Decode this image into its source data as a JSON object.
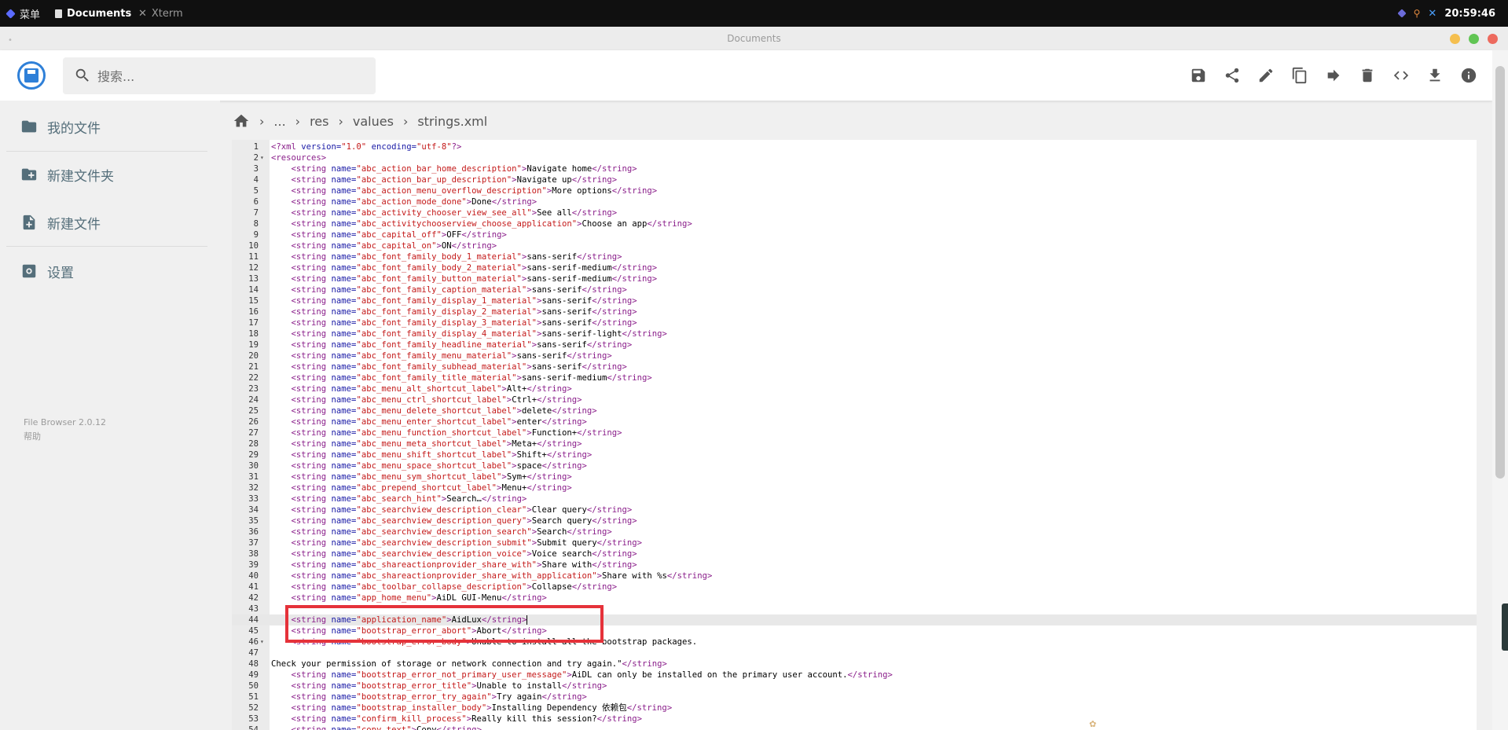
{
  "taskbar": {
    "menu_label": "菜单",
    "docs_label": "Documents",
    "xterm_label": "Xterm",
    "clock": "20:59:46"
  },
  "window": {
    "title": "Documents"
  },
  "search": {
    "placeholder": "搜索..."
  },
  "toolbar": {
    "actions": [
      "save",
      "share",
      "edit",
      "copy",
      "move",
      "delete",
      "code-view",
      "download",
      "info"
    ]
  },
  "sidebar": {
    "items": [
      {
        "label": "我的文件",
        "icon": "folder-icon"
      },
      {
        "label": "新建文件夹",
        "icon": "new-folder-icon"
      },
      {
        "label": "新建文件",
        "icon": "new-file-icon"
      },
      {
        "label": "设置",
        "icon": "settings-icon"
      }
    ],
    "footer_version": "File Browser 2.0.12",
    "footer_help": "帮助"
  },
  "breadcrumb": {
    "items": [
      "...",
      "res",
      "values",
      "strings.xml"
    ]
  },
  "editor": {
    "active_line": 44,
    "lines": [
      {
        "n": "1",
        "text": "<?xml version=\"1.0\" encoding=\"utf-8\"?>"
      },
      {
        "n": "2",
        "text": "<resources>",
        "fold": true
      },
      {
        "n": "3",
        "text": "    <string name=\"abc_action_bar_home_description\">Navigate home</string>"
      },
      {
        "n": "4",
        "text": "    <string name=\"abc_action_bar_up_description\">Navigate up</string>"
      },
      {
        "n": "5",
        "text": "    <string name=\"abc_action_menu_overflow_description\">More options</string>"
      },
      {
        "n": "6",
        "text": "    <string name=\"abc_action_mode_done\">Done</string>"
      },
      {
        "n": "7",
        "text": "    <string name=\"abc_activity_chooser_view_see_all\">See all</string>"
      },
      {
        "n": "8",
        "text": "    <string name=\"abc_activitychooserview_choose_application\">Choose an app</string>"
      },
      {
        "n": "9",
        "text": "    <string name=\"abc_capital_off\">OFF</string>"
      },
      {
        "n": "10",
        "text": "    <string name=\"abc_capital_on\">ON</string>"
      },
      {
        "n": "11",
        "text": "    <string name=\"abc_font_family_body_1_material\">sans-serif</string>"
      },
      {
        "n": "12",
        "text": "    <string name=\"abc_font_family_body_2_material\">sans-serif-medium</string>"
      },
      {
        "n": "13",
        "text": "    <string name=\"abc_font_family_button_material\">sans-serif-medium</string>"
      },
      {
        "n": "14",
        "text": "    <string name=\"abc_font_family_caption_material\">sans-serif</string>"
      },
      {
        "n": "15",
        "text": "    <string name=\"abc_font_family_display_1_material\">sans-serif</string>"
      },
      {
        "n": "16",
        "text": "    <string name=\"abc_font_family_display_2_material\">sans-serif</string>"
      },
      {
        "n": "17",
        "text": "    <string name=\"abc_font_family_display_3_material\">sans-serif</string>"
      },
      {
        "n": "18",
        "text": "    <string name=\"abc_font_family_display_4_material\">sans-serif-light</string>"
      },
      {
        "n": "19",
        "text": "    <string name=\"abc_font_family_headline_material\">sans-serif</string>"
      },
      {
        "n": "20",
        "text": "    <string name=\"abc_font_family_menu_material\">sans-serif</string>"
      },
      {
        "n": "21",
        "text": "    <string name=\"abc_font_family_subhead_material\">sans-serif</string>"
      },
      {
        "n": "22",
        "text": "    <string name=\"abc_font_family_title_material\">sans-serif-medium</string>"
      },
      {
        "n": "23",
        "text": "    <string name=\"abc_menu_alt_shortcut_label\">Alt+</string>"
      },
      {
        "n": "24",
        "text": "    <string name=\"abc_menu_ctrl_shortcut_label\">Ctrl+</string>"
      },
      {
        "n": "25",
        "text": "    <string name=\"abc_menu_delete_shortcut_label\">delete</string>"
      },
      {
        "n": "26",
        "text": "    <string name=\"abc_menu_enter_shortcut_label\">enter</string>"
      },
      {
        "n": "27",
        "text": "    <string name=\"abc_menu_function_shortcut_label\">Function+</string>"
      },
      {
        "n": "28",
        "text": "    <string name=\"abc_menu_meta_shortcut_label\">Meta+</string>"
      },
      {
        "n": "29",
        "text": "    <string name=\"abc_menu_shift_shortcut_label\">Shift+</string>"
      },
      {
        "n": "30",
        "text": "    <string name=\"abc_menu_space_shortcut_label\">space</string>"
      },
      {
        "n": "31",
        "text": "    <string name=\"abc_menu_sym_shortcut_label\">Sym+</string>"
      },
      {
        "n": "32",
        "text": "    <string name=\"abc_prepend_shortcut_label\">Menu+</string>"
      },
      {
        "n": "33",
        "text": "    <string name=\"abc_search_hint\">Search…</string>"
      },
      {
        "n": "34",
        "text": "    <string name=\"abc_searchview_description_clear\">Clear query</string>"
      },
      {
        "n": "35",
        "text": "    <string name=\"abc_searchview_description_query\">Search query</string>"
      },
      {
        "n": "36",
        "text": "    <string name=\"abc_searchview_description_search\">Search</string>"
      },
      {
        "n": "37",
        "text": "    <string name=\"abc_searchview_description_submit\">Submit query</string>"
      },
      {
        "n": "38",
        "text": "    <string name=\"abc_searchview_description_voice\">Voice search</string>"
      },
      {
        "n": "39",
        "text": "    <string name=\"abc_shareactionprovider_share_with\">Share with</string>"
      },
      {
        "n": "40",
        "text": "    <string name=\"abc_shareactionprovider_share_with_application\">Share with %s</string>"
      },
      {
        "n": "41",
        "text": "    <string name=\"abc_toolbar_collapse_description\">Collapse</string>"
      },
      {
        "n": "42",
        "text": "    <string name=\"app_home_menu\">AiDL GUI-Menu</string>"
      },
      {
        "n": "43",
        "text": ""
      },
      {
        "n": "44",
        "text": "    <string name=\"application_name\">AidLux</string>",
        "cursor": true
      },
      {
        "n": "45",
        "text": "    <string name=\"bootstrap_error_abort\">Abort</string>"
      },
      {
        "n": "46",
        "text": "    <string name=\"bootstrap_error_body\">Unable to install all the bootstrap packages.",
        "fold": true
      },
      {
        "n": "47",
        "text": ""
      },
      {
        "n": "48",
        "text": "Check your permission of storage or network connection and try again.\"</string>"
      },
      {
        "n": "49",
        "text": "    <string name=\"bootstrap_error_not_primary_user_message\">AiDL can only be installed on the primary user account.</string>"
      },
      {
        "n": "50",
        "text": "    <string name=\"bootstrap_error_title\">Unable to install</string>"
      },
      {
        "n": "51",
        "text": "    <string name=\"bootstrap_error_try_again\">Try again</string>"
      },
      {
        "n": "52",
        "text": "    <string name=\"bootstrap_installer_body\">Installing Dependency 依赖包</string>"
      },
      {
        "n": "53",
        "text": "    <string name=\"confirm_kill_process\">Really kill this session?</string>"
      },
      {
        "n": "54",
        "text": "    <string name=\"copy_text\">Copy</string>"
      }
    ]
  }
}
